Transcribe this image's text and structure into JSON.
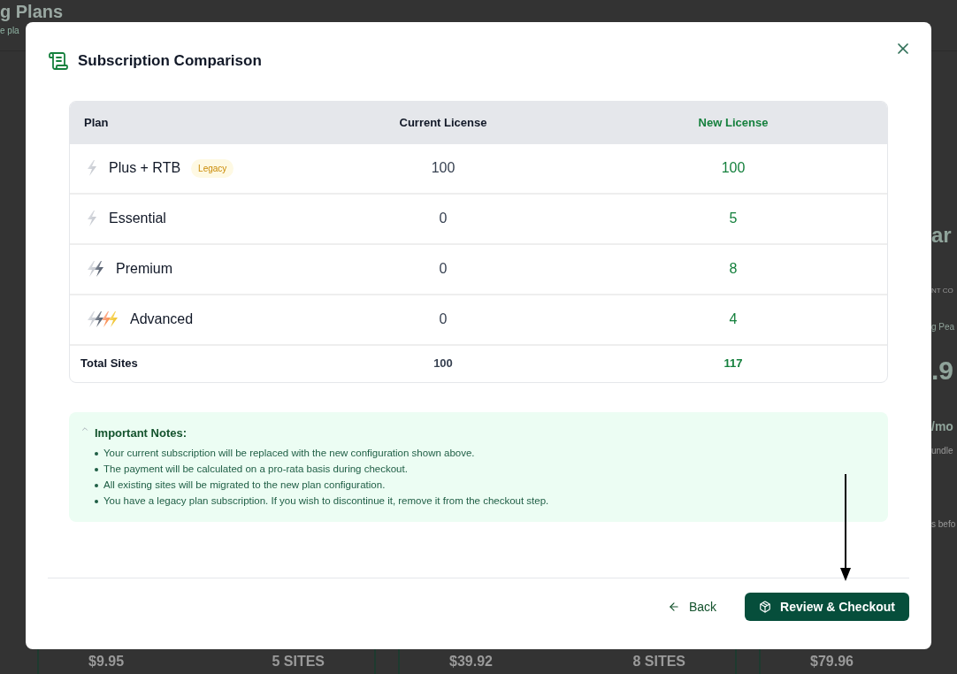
{
  "background": {
    "heading": "g Plans",
    "subheading": "e pla",
    "side_texts": [
      {
        "kind": "large",
        "text": "ar"
      },
      {
        "kind": "caps",
        "text": "NT CO"
      },
      {
        "kind": "accent",
        "text": "g Pea"
      },
      {
        "kind": "huge",
        "text": ".9"
      },
      {
        "kind": "medium",
        "text": "/mo"
      },
      {
        "kind": "small",
        "text": "undle"
      },
      {
        "kind": "small",
        "text": "s befo"
      }
    ],
    "cards": [
      {
        "price": "$9.95",
        "sites": "5 SITES"
      },
      {
        "price": "$39.92",
        "sites": "8 SITES"
      },
      {
        "price": "$79.96"
      }
    ]
  },
  "dialog": {
    "title": "Subscription Comparison",
    "table": {
      "columns": [
        "Plan",
        "Current License",
        "New License"
      ],
      "rows": [
        {
          "kind": "basic",
          "plan": "Plus + RTB",
          "badge": "Legacy",
          "current": "100",
          "new": "100"
        },
        {
          "kind": "basic",
          "plan": "Essential",
          "current": "0",
          "new": "5"
        },
        {
          "kind": "premium",
          "plan": "Premium",
          "current": "0",
          "new": "8"
        },
        {
          "kind": "advanced",
          "plan": "Advanced",
          "current": "0",
          "new": "4"
        }
      ],
      "total": {
        "label": "Total Sites",
        "current": "100",
        "new": "117"
      }
    },
    "notes": {
      "title": "Important Notes:",
      "expanded": true,
      "items": [
        "Your current subscription will be replaced with the new configuration shown above.",
        "The payment will be calculated on a pro-rata basis during checkout.",
        "All existing sites will be migrated to the new plan configuration.",
        "You have a legacy plan subscription. If you wish to discontinue it, remove it from the checkout step."
      ]
    },
    "buttons": {
      "back": "Back",
      "checkout": "Review & Checkout"
    }
  }
}
